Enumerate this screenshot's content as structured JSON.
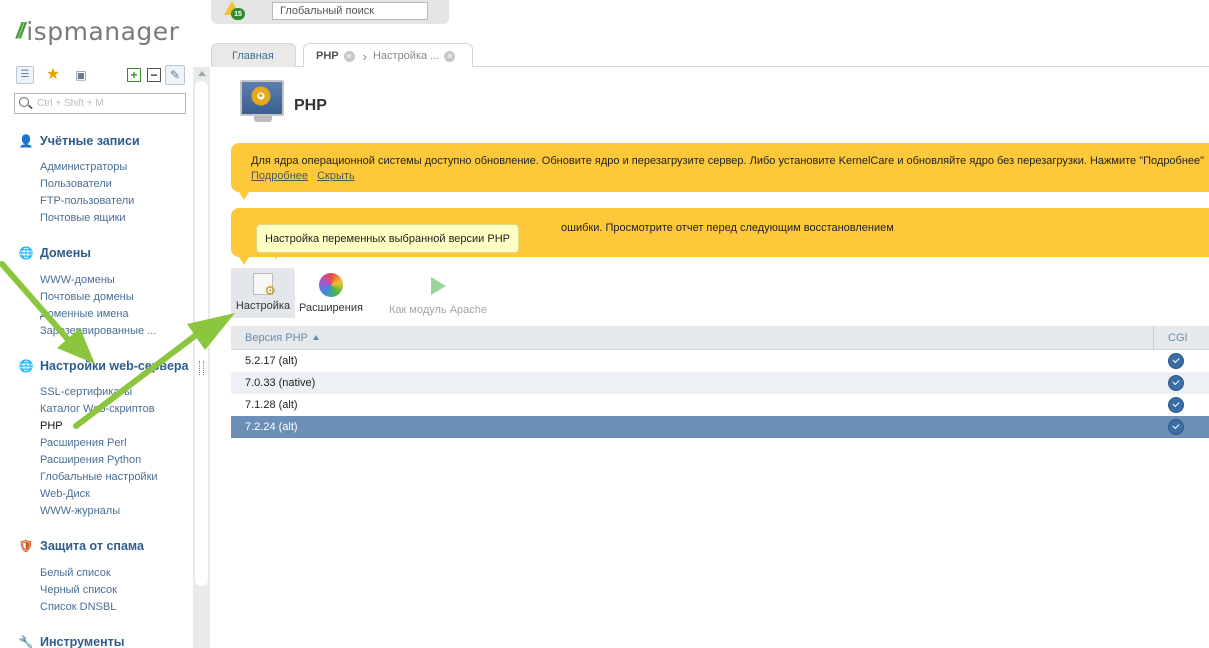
{
  "logo": {
    "slashes": "//",
    "text": "ispmanager"
  },
  "sidebar": {
    "search_placeholder": "Ctrl + Shift + M",
    "sections": [
      {
        "title": "Учётные записи",
        "icon": "users-icon",
        "items": [
          "Администраторы",
          "Пользователи",
          "FTP-пользователи",
          "Почтовые ящики"
        ]
      },
      {
        "title": "Домены",
        "icon": "globe-icon",
        "items": [
          "WWW-домены",
          "Почтовые домены",
          "Доменные имена",
          "Зарезервированные ..."
        ]
      },
      {
        "title": "Настройки web-сервера",
        "icon": "web-server-icon",
        "items": [
          "SSL-сертификаты",
          "Каталог Web-скриптов",
          "PHP",
          "Расширения Perl",
          "Расширения Python",
          "Глобальные настройки",
          "Web-Диск",
          "WWW-журналы"
        ]
      },
      {
        "title": "Защита от спама",
        "icon": "shield-icon",
        "items": [
          "Белый список",
          "Черный список",
          "Список DNSBL"
        ]
      },
      {
        "title": "Инструменты",
        "icon": "tools-icon",
        "items": []
      }
    ],
    "active_item": "PHP"
  },
  "topbar": {
    "alert_count": "15",
    "search_placeholder": "Глобальный поиск"
  },
  "tabs": [
    {
      "label": "Главная"
    },
    {
      "label": "PHP"
    },
    {
      "label": "Настройка ..."
    }
  ],
  "page": {
    "title": "PHP"
  },
  "banners": {
    "kernel": {
      "message": "Для ядра операционной системы доступно обновление. Обновите ядро и перезагрузите сервер. Либо установите KernelCare и обновляйте ядро без перезагрузки. Нажмите \"Подробнее\"",
      "links": [
        "Подробнее",
        "Скрыть"
      ]
    },
    "backup": {
      "message": "ошибки. Просмотрите отчет перед следующим восстановлением"
    }
  },
  "tooltip": "Настройка переменных выбранной версии PHP",
  "actions": [
    {
      "label": "Настройка",
      "icon": "settings-icon",
      "enabled": true
    },
    {
      "label": "Расширения",
      "icon": "extensions-icon",
      "enabled": true
    },
    {
      "label": "Как модуль Apache",
      "icon": "play-icon",
      "enabled": false
    }
  ],
  "table": {
    "columns": [
      "Версия PHP",
      "CGI"
    ],
    "rows": [
      {
        "version": "5.2.17 (alt)",
        "cgi": true
      },
      {
        "version": "7.0.33 (native)",
        "cgi": true
      },
      {
        "version": "7.1.28 (alt)",
        "cgi": true
      },
      {
        "version": "7.2.24 (alt)",
        "cgi": true,
        "selected": true
      }
    ]
  },
  "colors": {
    "accent_blue": "#2d5d8c",
    "banner_yellow": "#fdc93b",
    "selected_row": "#6c8fb8",
    "arrow_green": "#8cc63f"
  }
}
